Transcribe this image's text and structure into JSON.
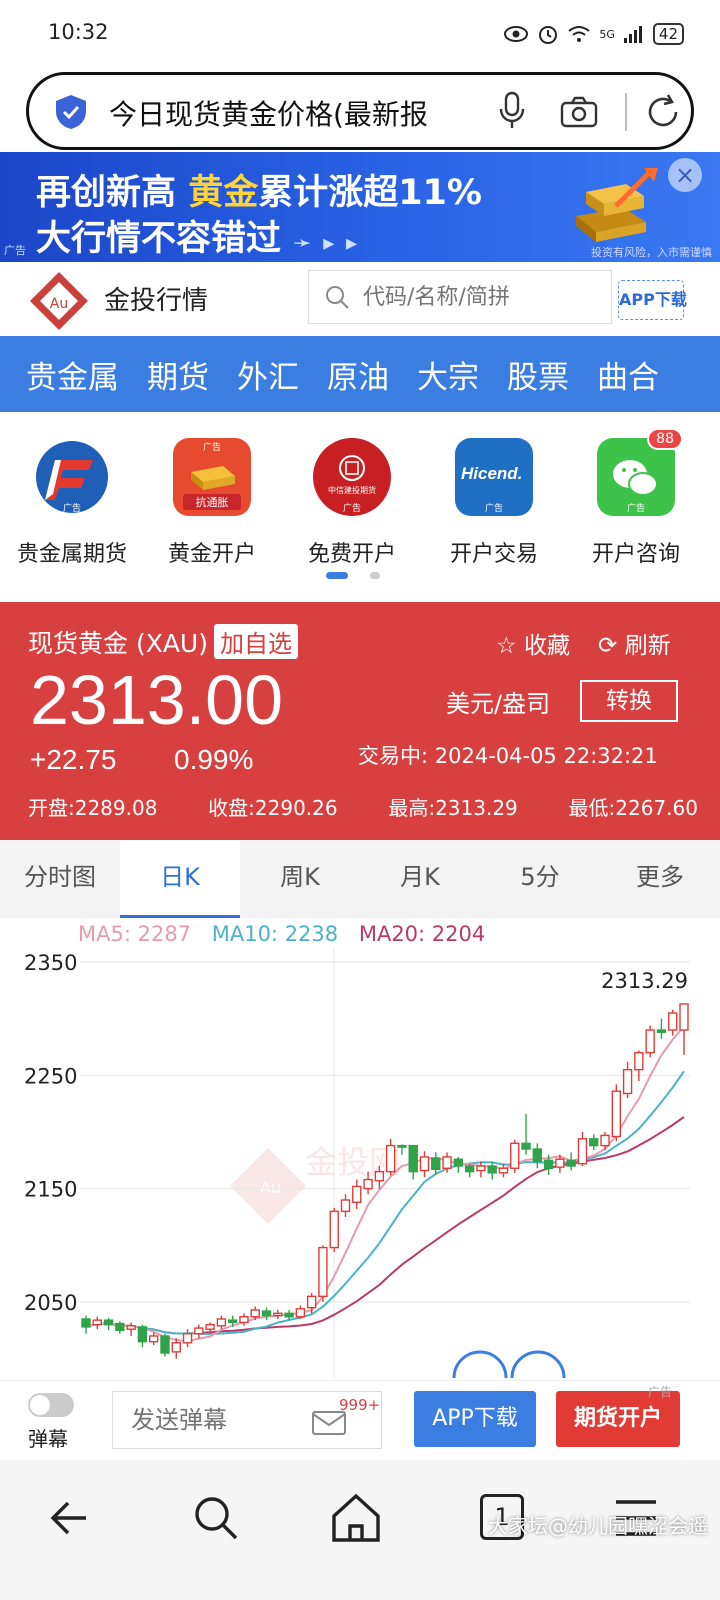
{
  "status_bar": {
    "time": "10:32",
    "battery": "42",
    "network": "5G"
  },
  "search": {
    "query": "今日现货黄金价格(最新报"
  },
  "banner": {
    "line1_a": "再创新高 ",
    "line1_gold": "黄金",
    "line1_b": "累计涨超11%",
    "line2": "大行情不容错过",
    "arrows": "➛ ▸ ▸",
    "ad_tag": "广告",
    "risk": "投资有风险，入市需谨慎",
    "close": "×"
  },
  "site": {
    "name": "金投行情",
    "search_placeholder": "代码/名称/简拼",
    "app_download": "APP下载"
  },
  "categories": [
    "贵金属",
    "期货",
    "外汇",
    "原油",
    "大宗",
    "股票",
    "曲合"
  ],
  "apps": [
    {
      "label": "贵金属期货",
      "ad": "广告"
    },
    {
      "label": "黄金开户",
      "ad": "广告",
      "sub": "抗通胀"
    },
    {
      "label": "免费开户",
      "ad": "广告",
      "sub": "中信建投期货"
    },
    {
      "label": "开户交易",
      "ad": "广告",
      "sub": "Hicend."
    },
    {
      "label": "开户咨询",
      "ad": "广告",
      "badge": "88"
    }
  ],
  "quote": {
    "title": "现货黄金 (XAU)",
    "add_fav": "加自选",
    "collect": "收藏",
    "refresh": "刷新",
    "price": "2313.00",
    "unit": "美元/盎司",
    "convert": "转换",
    "change": "+22.75",
    "change_pct": "0.99%",
    "status": "交易中:  2024-04-05 22:32:21",
    "open": "开盘:2289.08",
    "prev_close": "收盘:2290.26",
    "high": "最高:2313.29",
    "low": "最低:2267.60",
    "accent": "#d8403f"
  },
  "chart_tabs": [
    {
      "label": "分时图",
      "active": false
    },
    {
      "label": "日K",
      "active": true
    },
    {
      "label": "周K",
      "active": false
    },
    {
      "label": "月K",
      "active": false
    },
    {
      "label": "5分",
      "active": false
    },
    {
      "label": "更多",
      "active": false
    }
  ],
  "chart_data": {
    "type": "candlestick",
    "ma5_label": "MA5: 2287",
    "ma10_label": "MA10: 2238",
    "ma20_label": "MA20: 2204",
    "max_label": "2313.29",
    "y_ticks": [
      2350,
      2250,
      2150,
      2050
    ],
    "ylim": [
      2040,
      2350
    ],
    "watermark": "金投网",
    "candles": [
      [
        2035,
        2028,
        2038,
        2022
      ],
      [
        2030,
        2034,
        2037,
        2026
      ],
      [
        2034,
        2030,
        2036,
        2025
      ],
      [
        2031,
        2025,
        2033,
        2022
      ],
      [
        2026,
        2029,
        2032,
        2020
      ],
      [
        2028,
        2015,
        2030,
        2010
      ],
      [
        2015,
        2020,
        2023,
        2012
      ],
      [
        2020,
        2005,
        2022,
        2002
      ],
      [
        2006,
        2014,
        2018,
        2000
      ],
      [
        2014,
        2022,
        2026,
        2010
      ],
      [
        2022,
        2027,
        2030,
        2018
      ],
      [
        2026,
        2030,
        2032,
        2023
      ],
      [
        2029,
        2035,
        2038,
        2026
      ],
      [
        2034,
        2032,
        2038,
        2028
      ],
      [
        2032,
        2037,
        2040,
        2029
      ],
      [
        2037,
        2043,
        2046,
        2034
      ],
      [
        2042,
        2038,
        2045,
        2034
      ],
      [
        2038,
        2040,
        2043,
        2035
      ],
      [
        2040,
        2037,
        2043,
        2034
      ],
      [
        2037,
        2044,
        2047,
        2035
      ],
      [
        2045,
        2055,
        2058,
        2040
      ],
      [
        2055,
        2098,
        2100,
        2050
      ],
      [
        2098,
        2130,
        2133,
        2094
      ],
      [
        2130,
        2140,
        2145,
        2125
      ],
      [
        2138,
        2152,
        2158,
        2132
      ],
      [
        2150,
        2158,
        2165,
        2145
      ],
      [
        2157,
        2165,
        2170,
        2150
      ],
      [
        2165,
        2188,
        2194,
        2162
      ],
      [
        2188,
        2187,
        2189,
        2180
      ],
      [
        2188,
        2165,
        2188,
        2158
      ],
      [
        2166,
        2178,
        2183,
        2160
      ],
      [
        2177,
        2167,
        2182,
        2162
      ],
      [
        2168,
        2178,
        2182,
        2164
      ],
      [
        2176,
        2170,
        2178,
        2164
      ],
      [
        2170,
        2165,
        2172,
        2160
      ],
      [
        2166,
        2170,
        2174,
        2160
      ],
      [
        2170,
        2164,
        2174,
        2158
      ],
      [
        2164,
        2168,
        2172,
        2160
      ],
      [
        2168,
        2190,
        2193,
        2164
      ],
      [
        2190,
        2185,
        2216,
        2180
      ],
      [
        2185,
        2174,
        2190,
        2168
      ],
      [
        2175,
        2168,
        2180,
        2162
      ],
      [
        2169,
        2176,
        2180,
        2164
      ],
      [
        2175,
        2170,
        2182,
        2166
      ],
      [
        2172,
        2194,
        2200,
        2170
      ],
      [
        2194,
        2188,
        2198,
        2184
      ],
      [
        2188,
        2197,
        2200,
        2184
      ],
      [
        2196,
        2236,
        2242,
        2192
      ],
      [
        2234,
        2255,
        2262,
        2230
      ],
      [
        2255,
        2270,
        2272,
        2245
      ],
      [
        2270,
        2290,
        2294,
        2266
      ],
      [
        2290,
        2288,
        2300,
        2282
      ],
      [
        2290,
        2305,
        2308,
        2285
      ],
      [
        2290,
        2313,
        2313,
        2268
      ]
    ]
  },
  "action_bar": {
    "danmu_label": "弹幕",
    "danmu_placeholder": "发送弹幕",
    "danmu_count": "999+",
    "app_download": "APP下载",
    "futures_open": "期货开户",
    "ad": "广告"
  },
  "browser_nav": {
    "tab_count": "1",
    "watermark": "大家坛@幼儿园嘿涩会遥"
  }
}
